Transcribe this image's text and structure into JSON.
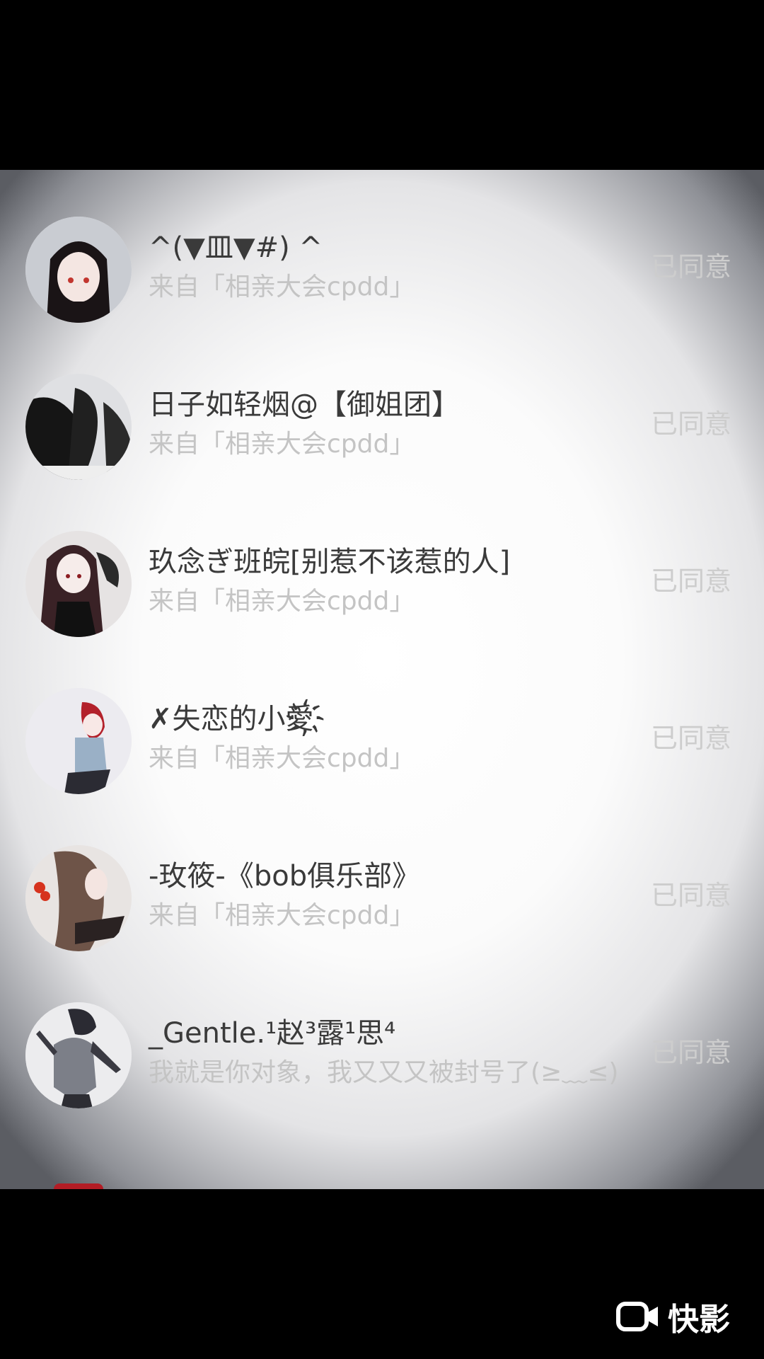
{
  "requests": [
    {
      "name": "^(▼皿▼#) ^",
      "source": "来自「相亲大会cpdd」",
      "status": "已同意",
      "avatar": "anime-girl-dark-hair-avatar"
    },
    {
      "name": "日子如轻烟@【御姐团】",
      "source": "来自「相亲大会cpdd」",
      "status": "已同意",
      "avatar": "dark-silhouette-avatar"
    },
    {
      "name": "玖念ぎ班皖[别惹不该惹的人]",
      "source": "来自「相亲大会cpdd」",
      "status": "已同意",
      "avatar": "anime-girl-black-dress-avatar"
    },
    {
      "name": "✗失恋的小愛҉",
      "source": "来自「相亲大会cpdd」",
      "status": "已同意",
      "avatar": "anime-girl-red-hair-avatar"
    },
    {
      "name": "-玫筱-《bob俱乐部》",
      "source": "来自「相亲大会cpdd」",
      "status": "已同意",
      "avatar": "anime-girl-brown-hair-avatar"
    },
    {
      "name": "_Gentle.¹赵³露¹思⁴",
      "source": "我就是你对象，我又又又被封号了(≥﹏≤)",
      "status": "已同意",
      "avatar": "anime-figure-grey-avatar"
    }
  ],
  "watermark": {
    "text": "快影",
    "icon": "kuaiying-camera-icon"
  }
}
